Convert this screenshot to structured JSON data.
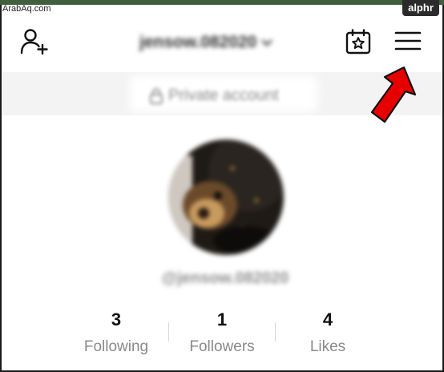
{
  "watermark": "ArabAq.com",
  "badge": "alphr",
  "header": {
    "username": "jensow.082020",
    "icons": {
      "add_user": "add-user-icon",
      "calendar": "calendar-star-icon",
      "menu": "hamburger-menu-icon",
      "dropdown": "chevron-down-icon"
    }
  },
  "private": {
    "label": "Private account",
    "icon": "lock-icon"
  },
  "profile": {
    "handle": "@jensow.082020"
  },
  "stats": [
    {
      "value": "3",
      "label": "Following"
    },
    {
      "value": "1",
      "label": "Followers"
    },
    {
      "value": "4",
      "label": "Likes"
    }
  ],
  "colors": {
    "arrow": "#e60000",
    "text_primary": "#111111",
    "text_secondary": "#8a8a8a",
    "private_bar": "#f3f3f3"
  }
}
